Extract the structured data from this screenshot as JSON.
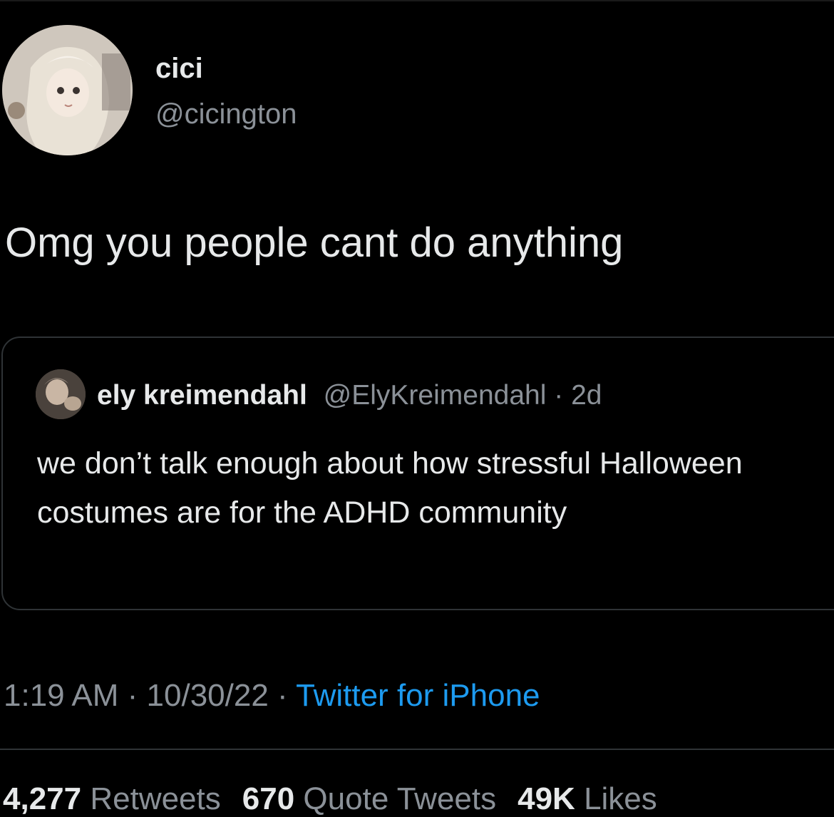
{
  "tweet": {
    "display_name": "cici",
    "handle": "@cicington",
    "text": "Omg you people cant do anything"
  },
  "quoted_tweet": {
    "display_name": "ely kreimendahl",
    "handle": "@ElyKreimendahl",
    "separator": " · ",
    "age": "2d",
    "text": "we don’t talk enough about how stressful Halloween costumes are for the ADHD community"
  },
  "meta": {
    "time": "1:19 AM",
    "sep1": " · ",
    "date": "10/30/22",
    "sep2": " · ",
    "source": "Twitter for iPhone"
  },
  "stats": {
    "retweets_count": "4,277",
    "retweets_label": "Retweets",
    "quotes_count": "670",
    "quotes_label": "Quote Tweets",
    "likes_count": "49K",
    "likes_label": "Likes"
  },
  "colors": {
    "background": "#000000",
    "primary_text": "#e7e9ea",
    "secondary_text": "#8b9198",
    "link": "#1d9bf0",
    "border": "#2f3336"
  }
}
